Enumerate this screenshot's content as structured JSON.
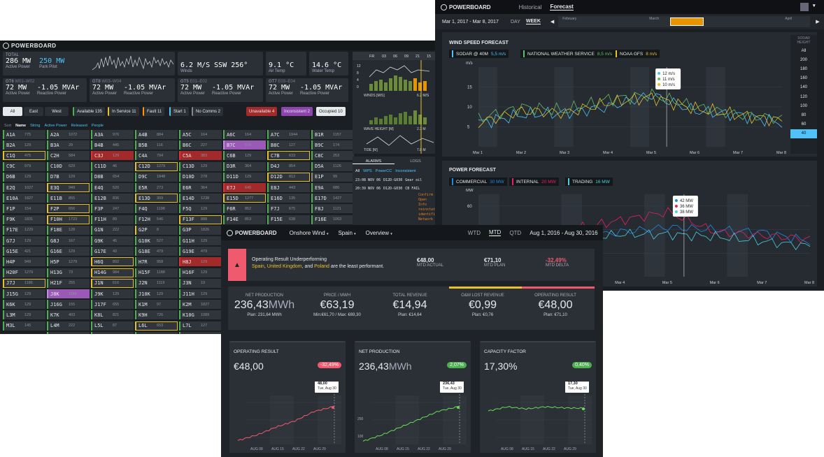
{
  "brand": "POWERBOARD",
  "turbine": {
    "total": {
      "label": "TOTAL",
      "active": "286 MW",
      "active_label": "Active Power",
      "park": "250 MW",
      "park_label": "Park Pilot"
    },
    "wind": {
      "value": "6.2 M/S SSW 256°",
      "label": "Winds"
    },
    "air": {
      "value": "9.1 °C",
      "label": "Air Temp"
    },
    "water": {
      "value": "14.6 °C",
      "label": "Water Temp"
    },
    "groups": [
      {
        "name": "GT6",
        "range": "W01–W02",
        "mw": "72 MW",
        "mvar": "-1.05 MVAr",
        "mw_label": "Active Power",
        "mvar_label": "Reactive Power"
      },
      {
        "name": "GT8",
        "range": "W03–W04",
        "mw": "72 MW",
        "mvar": "-1.05 MVAr",
        "mw_label": "Active Power",
        "mvar_label": "Reactive Power"
      },
      {
        "name": "GT5",
        "range": "E01–E02",
        "mw": "72 MW",
        "mvar": "-1.05 MVAr",
        "mw_label": "Active Power",
        "mvar_label": "Reactive Power"
      },
      {
        "name": "GT7",
        "range": "E03–E04",
        "mw": "72 MW",
        "mvar": "-1.05 MVAr",
        "mw_label": "Active Power",
        "mvar_label": "Reactive Power"
      }
    ],
    "regions": [
      "All",
      "East",
      "West"
    ],
    "filters": [
      "Available 135",
      "In Service 11",
      "Fault 11",
      "Start 1",
      "No Comms 2",
      "Unavailable 4",
      "Inconsistent 2",
      "Occupied 10"
    ],
    "sort": [
      "Sort",
      "Name",
      "String",
      "Active Power",
      "Released",
      "People"
    ],
    "cells": [
      [
        [
          "A1A",
          "775"
        ],
        [
          "B2A",
          "129"
        ],
        [
          "C1Q",
          "475"
        ],
        [
          "C9C",
          "979"
        ],
        [
          "D6B",
          "129"
        ],
        [
          "E2Q",
          "1027"
        ],
        [
          "E10A",
          "1827"
        ],
        [
          "F1P",
          "154"
        ],
        [
          "F9K",
          "1831"
        ],
        [
          "F17E",
          "1229"
        ],
        [
          "G7J",
          "129"
        ],
        [
          "G15E",
          "421"
        ],
        [
          "H4P",
          "949"
        ],
        [
          "H20F",
          "1279"
        ],
        [
          "J7J",
          "1186"
        ],
        [
          "J15G",
          "129"
        ],
        [
          "K6K",
          "129"
        ],
        [
          "L3M",
          "129"
        ],
        [
          "M3L",
          "145"
        ]
      ],
      [
        [
          "A2A",
          "1072"
        ],
        [
          "B3A",
          "29"
        ],
        [
          "C2H",
          "584"
        ],
        [
          "C10D",
          "629"
        ],
        [
          "D7B",
          "129"
        ],
        [
          "E3Q",
          "949"
        ],
        [
          "E11B",
          "855"
        ],
        [
          "F2P",
          "656"
        ],
        [
          "F10H",
          "1723"
        ],
        [
          "F18E",
          "128"
        ],
        [
          "G8J",
          "167"
        ],
        [
          "G16E",
          "129"
        ],
        [
          "H5P",
          "1279"
        ],
        [
          "H13G",
          "73"
        ],
        [
          "H21F",
          "255"
        ],
        [
          "J8K",
          "1184"
        ],
        [
          "J16G",
          "155"
        ],
        [
          "K7K",
          "403"
        ],
        [
          "L4M",
          "222"
        ],
        [
          "M4L",
          "222"
        ]
      ],
      [
        [
          "A3A",
          "976"
        ],
        [
          "B4B",
          "445"
        ],
        [
          "C3J",
          "129"
        ],
        [
          "C11D",
          "46"
        ],
        [
          "D8B",
          "654"
        ],
        [
          "E4Q",
          "520"
        ],
        [
          "E12B",
          "836"
        ],
        [
          "F3P",
          "247"
        ],
        [
          "F11H",
          "89"
        ],
        [
          "G1N",
          "222"
        ],
        [
          "G9K",
          "45"
        ],
        [
          "G17E",
          "49"
        ],
        [
          "H6Q",
          "892"
        ],
        [
          "H14G",
          "984"
        ],
        [
          "J1N",
          "616"
        ],
        [
          "J9K",
          "129"
        ],
        [
          "J17F",
          "655"
        ],
        [
          "K8L",
          "821"
        ],
        [
          "L5L",
          "87"
        ],
        [
          "M5L",
          "911"
        ]
      ],
      [
        [
          "A4B",
          "884"
        ],
        [
          "B5B",
          "116"
        ],
        [
          "C4A",
          "794"
        ],
        [
          "C12D",
          "1279"
        ],
        [
          "D9C",
          "1848"
        ],
        [
          "E5R",
          "273"
        ],
        [
          "E13D",
          "309"
        ],
        [
          "F4Q",
          "1198"
        ],
        [
          "F12H",
          "546"
        ],
        [
          "G2P",
          "8"
        ],
        [
          "G10K",
          "527"
        ],
        [
          "G18E",
          "479"
        ],
        [
          "H7R",
          "958"
        ],
        [
          "H15F",
          "1188"
        ],
        [
          "J2N",
          "1119"
        ],
        [
          "J10K",
          "129"
        ],
        [
          "K1M",
          "97"
        ],
        [
          "K9H",
          "726"
        ],
        [
          "L6L",
          "653"
        ],
        [
          "N1M",
          "1866"
        ]
      ],
      [
        [
          "A5C",
          "164"
        ],
        [
          "B6C",
          "227"
        ],
        [
          "C5A",
          "383"
        ],
        [
          "C13D",
          "129"
        ],
        [
          "D10D",
          "278"
        ],
        [
          "E6R",
          "364"
        ],
        [
          "E14D",
          "1238"
        ],
        [
          "F5Q",
          "129"
        ],
        [
          "F13F",
          "888"
        ],
        [
          "G3P",
          "1826"
        ],
        [
          "G11H",
          "129"
        ],
        [
          "G19E",
          "479"
        ],
        [
          "H8J",
          "129"
        ],
        [
          "H16F",
          "129"
        ],
        [
          "J3N",
          "19"
        ],
        [
          "J11H",
          "129"
        ],
        [
          "K2M",
          "1827"
        ],
        [
          "K10G",
          "1089"
        ],
        [
          "L7L",
          "127"
        ],
        [
          "N2M",
          "1827"
        ]
      ],
      [
        [
          "A6C",
          "164"
        ],
        [
          "B7C",
          "576"
        ],
        [
          "C6B",
          "129"
        ],
        [
          "D3R",
          "364"
        ],
        [
          "D11D",
          "129"
        ],
        [
          "E7J",
          "645"
        ],
        [
          "E15D",
          "1277"
        ],
        [
          "F6R",
          "852"
        ],
        [
          "F14E",
          "853"
        ],
        [
          "G4P",
          "129"
        ],
        [
          "G12H",
          "129"
        ]
      ],
      [
        [
          "A7C",
          "1944"
        ],
        [
          "B8C",
          "127"
        ],
        [
          "C7B",
          "633"
        ],
        [
          "D4J",
          "854"
        ],
        [
          "D12D",
          "812"
        ],
        [
          "E8J",
          "443"
        ],
        [
          "E16D",
          "135"
        ],
        [
          "F7J",
          "675"
        ],
        [
          "F15E",
          "638"
        ],
        [
          "G5P",
          "129"
        ],
        [
          "G13H",
          "129"
        ]
      ],
      [
        [
          "B1R",
          "1157"
        ],
        [
          "B9C",
          "174"
        ],
        [
          "C8C",
          "253"
        ],
        [
          "D5A",
          "1126"
        ],
        [
          "E1P",
          "99"
        ],
        [
          "E9A",
          "686"
        ],
        [
          "E17D",
          "1427"
        ],
        [
          "F8J",
          "1121"
        ],
        [
          "F16E",
          "1063"
        ],
        [
          "G6P",
          "129"
        ],
        [
          "G14H",
          "129"
        ]
      ]
    ],
    "met": {
      "days": [
        "FR",
        "03",
        "06",
        "09",
        "21",
        "15"
      ],
      "winds_label": "WINDS [M/S]",
      "winds_val": "6.2 M/S",
      "wave_label": "WAVE HEIGHT [M]",
      "wave_val": "2.3 M",
      "tide_label": "TIDE [M]",
      "tide_val": "7.8 M",
      "y12": "12",
      "y8": "8",
      "y4": "4",
      "y0": "0"
    },
    "alarms": {
      "tabs": [
        "ALARMS",
        "LOGS"
      ],
      "filters": [
        "All",
        "WPS",
        "PowerCC",
        "Inconsistent"
      ],
      "rows": [
        {
          "time": "23:08 NOV 06",
          "id": "D12D-G030",
          "msg": "Gear oil"
        },
        {
          "time": "20:39 NOV 06",
          "id": "D12D-G030",
          "msg": "CB FAIL"
        }
      ],
      "detail": [
        "Confirm",
        "Open Info",
        "reinstate",
        "identific",
        "Network"
      ]
    }
  },
  "forecast": {
    "tabs": [
      "Historical",
      "Forecast"
    ],
    "range": "Mar 1, 2017 - Mar 8, 2017",
    "periods": [
      "DAY",
      "WEEK"
    ],
    "timeline": [
      "February",
      "March",
      "April"
    ],
    "wind": {
      "title": "WIND SPEED FORECAST",
      "sources": [
        {
          "name": "SODAR @ 40M",
          "value": "5,5 m/s",
          "color": "#4fc3f7"
        },
        {
          "name": "NATIONAL WEATHER SERVICE",
          "value": "8,5 m/s",
          "color": "#66bb6a"
        },
        {
          "name": "NOAA GFS",
          "value": "8 m/s",
          "color": "#e6c12a"
        }
      ],
      "unit": "m/s",
      "yticks": [
        "15",
        "10",
        "5"
      ],
      "xticks": [
        "Mar 1",
        "Mar 2",
        "Mar 3",
        "Mar 4",
        "Mar 5",
        "Mar 6",
        "Mar 7",
        "Mar 8"
      ],
      "tooltip": [
        "12 m/s",
        "11 m/s",
        "10 m/s"
      ],
      "sodar_label": "SODAR HEIGHT",
      "heights": [
        "All",
        "200",
        "180",
        "160",
        "140",
        "120",
        "100",
        "80",
        "60",
        "40"
      ],
      "selected_height": "40"
    },
    "power": {
      "title": "POWER FORECAST",
      "sources": [
        {
          "name": "COMMERCIAL",
          "value": "30 MW",
          "color": "#1e88e5"
        },
        {
          "name": "INTERNAL",
          "value": "20 MW",
          "color": "#e91e63"
        },
        {
          "name": "TRADING",
          "value": "16 MW",
          "color": "#4dd0e1"
        }
      ],
      "unit": "MW",
      "yticks": [
        "60",
        "40",
        "20"
      ],
      "xticks": [
        "Mar 1",
        "Mar 2",
        "Mar 3",
        "Mar 4",
        "Mar 5",
        "Mar 6",
        "Mar 7",
        "Mar 8"
      ],
      "tooltip": [
        "42 MW",
        "36 MW",
        "38 MW"
      ]
    }
  },
  "result": {
    "nav": [
      "Onshore Wind",
      "Spain",
      "Overview"
    ],
    "periods": [
      "WTD",
      "MTD",
      "QTD"
    ],
    "range": "Aug 1, 2016 - Aug 30, 2016",
    "alert": {
      "title": "Operating Result Underperforming",
      "countries": [
        "Spain",
        "United Kingdom",
        "Poland"
      ],
      "sep1": ", ",
      "sep2": ", and ",
      "suffix": " are the least performant."
    },
    "mtd": [
      {
        "value": "€48,00",
        "label": "MTD ACTUAL"
      },
      {
        "value": "€71,10",
        "label": "MTD PLAN"
      },
      {
        "value": "-32,49%",
        "label": "MTD DELTA"
      }
    ],
    "kpis": [
      {
        "title": "NET PRODUCTION",
        "value": "236,43",
        "unit": "MWh",
        "plan": "Plan: 231,64 MWh"
      },
      {
        "title": "PRICE / MWh",
        "value": "€63,19",
        "unit": "",
        "plan": "Min:€61,70 / Max: €69,30"
      },
      {
        "title": "TOTAL REVENUE",
        "value": "€14,94",
        "unit": "",
        "plan": "Plan: €14,64"
      },
      {
        "title": "O&M LOST REVENUE",
        "value": "€0,99",
        "unit": "",
        "plan": "Plan: €0,76"
      },
      {
        "title": "OPERATING RESULT",
        "value": "€48,00",
        "unit": "",
        "plan": "Plan: €71,10"
      }
    ],
    "cards": [
      {
        "title": "OPERATING RESULT",
        "value": "€48,00",
        "unit": "",
        "badge": "-32,49%",
        "tip": "48,00",
        "tipdate": "Tue, Aug 30",
        "color": "#ef5a6f"
      },
      {
        "title": "NET PRODUCTION",
        "value": "236,43",
        "unit": "MWh",
        "badge": "2,07%",
        "tip": "236,43",
        "tipdate": "Tue, Aug 30",
        "color": "#66dd55"
      },
      {
        "title": "CAPACITY FACTOR",
        "value": "17,30%",
        "unit": "",
        "badge": "0,40%",
        "tip": "17,30",
        "tipdate": "Tue, Aug 30",
        "color": "#66dd55"
      }
    ],
    "card_y": [
      "",
      "250",
      "100",
      ""
    ],
    "card_x": [
      "AUG 08",
      "AUG 15",
      "AUG 22",
      "AUG 29"
    ]
  },
  "chart_data": [
    {
      "type": "line",
      "title": "WIND SPEED FORECAST",
      "ylabel": "m/s",
      "x": [
        "Mar 1",
        "Mar 2",
        "Mar 3",
        "Mar 4",
        "Mar 5",
        "Mar 6",
        "Mar 7",
        "Mar 8"
      ],
      "ylim": [
        0,
        20
      ],
      "series": [
        {
          "name": "SODAR @ 40M",
          "values": [
            6,
            8,
            8.5,
            10,
            13,
            9,
            8,
            6
          ]
        },
        {
          "name": "NATIONAL WEATHER SERVICE",
          "values": [
            7,
            10,
            9,
            12,
            13,
            10,
            8,
            7
          ]
        },
        {
          "name": "NOAA GFS",
          "values": [
            6,
            9,
            8.5,
            11,
            12.5,
            9.5,
            8,
            6.5
          ]
        }
      ]
    },
    {
      "type": "line",
      "title": "POWER FORECAST",
      "ylabel": "MW",
      "x": [
        "Mar 1",
        "Mar 2",
        "Mar 3",
        "Mar 4",
        "Mar 5",
        "Mar 6",
        "Mar 7",
        "Mar 8"
      ],
      "ylim": [
        0,
        70
      ],
      "series": [
        {
          "name": "COMMERCIAL",
          "values": [
            32,
            30,
            33,
            38,
            42,
            40,
            38,
            30
          ]
        },
        {
          "name": "INTERNAL",
          "values": [
            30,
            35,
            40,
            48,
            55,
            38,
            35,
            32
          ]
        },
        {
          "name": "TRADING",
          "values": [
            28,
            30,
            32,
            36,
            36,
            34,
            30,
            26
          ]
        }
      ]
    },
    {
      "type": "line",
      "title": "OPERATING RESULT",
      "x": [
        "AUG 01",
        "AUG 08",
        "AUG 15",
        "AUG 22",
        "AUG 29",
        "AUG 30"
      ],
      "series": [
        {
          "name": "OPERATING RESULT",
          "values": [
            5,
            12,
            22,
            30,
            42,
            48
          ]
        }
      ]
    },
    {
      "type": "line",
      "title": "NET PRODUCTION",
      "x": [
        "AUG 01",
        "AUG 08",
        "AUG 15",
        "AUG 22",
        "AUG 29",
        "AUG 30"
      ],
      "series": [
        {
          "name": "NET PRODUCTION",
          "values": [
            20,
            60,
            110,
            160,
            210,
            236
          ]
        }
      ]
    },
    {
      "type": "line",
      "title": "CAPACITY FACTOR",
      "x": [
        "AUG 01",
        "AUG 08",
        "AUG 15",
        "AUG 22",
        "AUG 29",
        "AUG 30"
      ],
      "series": [
        {
          "name": "CAPACITY FACTOR",
          "values": [
            16,
            18,
            17,
            18,
            17.5,
            17.3
          ]
        }
      ]
    }
  ]
}
